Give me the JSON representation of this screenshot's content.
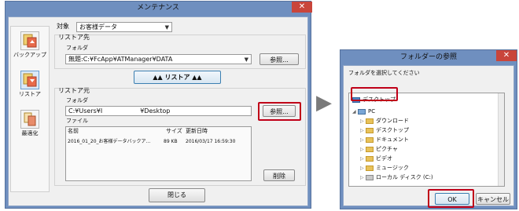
{
  "maintenance": {
    "title": "メンテナンス",
    "close": "✕",
    "nav": [
      {
        "label": "バックアップ",
        "icon": "backup-icon"
      },
      {
        "label": "リストア",
        "icon": "restore-icon"
      },
      {
        "label": "最適化",
        "icon": "optimize-icon"
      }
    ],
    "target_label": "対象",
    "target_value": "お客様データ",
    "restore_from": {
      "group_label": "リストア先",
      "folder_label": "フォルダ",
      "folder_value": "無題:C:¥FcApp¥ATManager¥DATA",
      "browse": "参照..."
    },
    "restore_button": "▲▲ リストア ▲▲",
    "restore_source": {
      "group_label": "リストア元",
      "folder_label": "フォルダ",
      "folder_value": "C:¥Users¥I　　　　　　¥Desktop",
      "browse": "参照...",
      "file_label": "ファイル",
      "columns": {
        "name": "名前",
        "size": "サイズ",
        "modified": "更新日時"
      },
      "files": [
        {
          "name": "2016_01_20_お客様データバックア...",
          "size": "89 KB",
          "modified": "2016/03/17 16:59:30"
        }
      ],
      "delete": "削除"
    },
    "close_button": "閉じる"
  },
  "arrow": "▶",
  "browse_dialog": {
    "title": "フォルダーの参照",
    "close": "✕",
    "prompt": "フォルダを選択してください",
    "tree": [
      {
        "label": "デスクトップ",
        "level": 0,
        "selected": true,
        "icon": "desktop-icon"
      },
      {
        "label": "PC",
        "level": 1,
        "icon": "computer-icon"
      },
      {
        "label": "ダウンロード",
        "level": 2,
        "icon": "folder-icon"
      },
      {
        "label": "デスクトップ",
        "level": 2,
        "icon": "folder-icon"
      },
      {
        "label": "ドキュメント",
        "level": 2,
        "icon": "folder-icon"
      },
      {
        "label": "ピクチャ",
        "level": 2,
        "icon": "folder-icon"
      },
      {
        "label": "ビデオ",
        "level": 2,
        "icon": "folder-icon"
      },
      {
        "label": "ミュージック",
        "level": 2,
        "icon": "folder-icon"
      },
      {
        "label": "ローカル ディスク (C:)",
        "level": 2,
        "icon": "drive-icon"
      }
    ],
    "ok": "OK",
    "cancel": "キャンセル"
  }
}
